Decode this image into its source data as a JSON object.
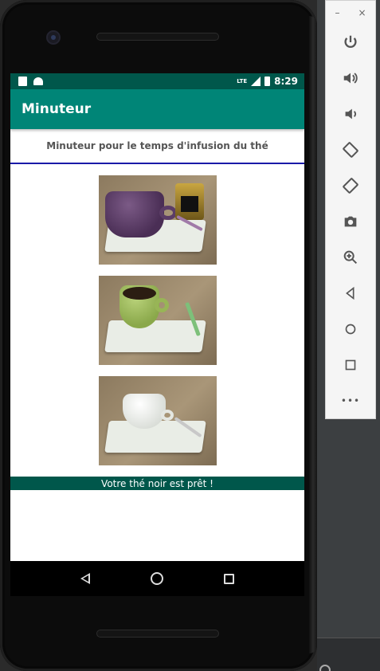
{
  "status_bar": {
    "network": "LTE",
    "time": "8:29"
  },
  "app": {
    "title": "Minuteur",
    "subtitle": "Minuteur pour le temps d'infusion du thé",
    "ready_message": "Votre thé noir est prêt !"
  },
  "images": [
    {
      "name": "purple-cup-photo"
    },
    {
      "name": "green-cup-photo"
    },
    {
      "name": "white-cup-photo"
    }
  ],
  "emulator_toolbar": {
    "minimize": "–",
    "close": "×",
    "more": "•••"
  },
  "colors": {
    "primary": "#008577",
    "primary_dark": "#00574b",
    "divider": "#1a1aa8"
  }
}
